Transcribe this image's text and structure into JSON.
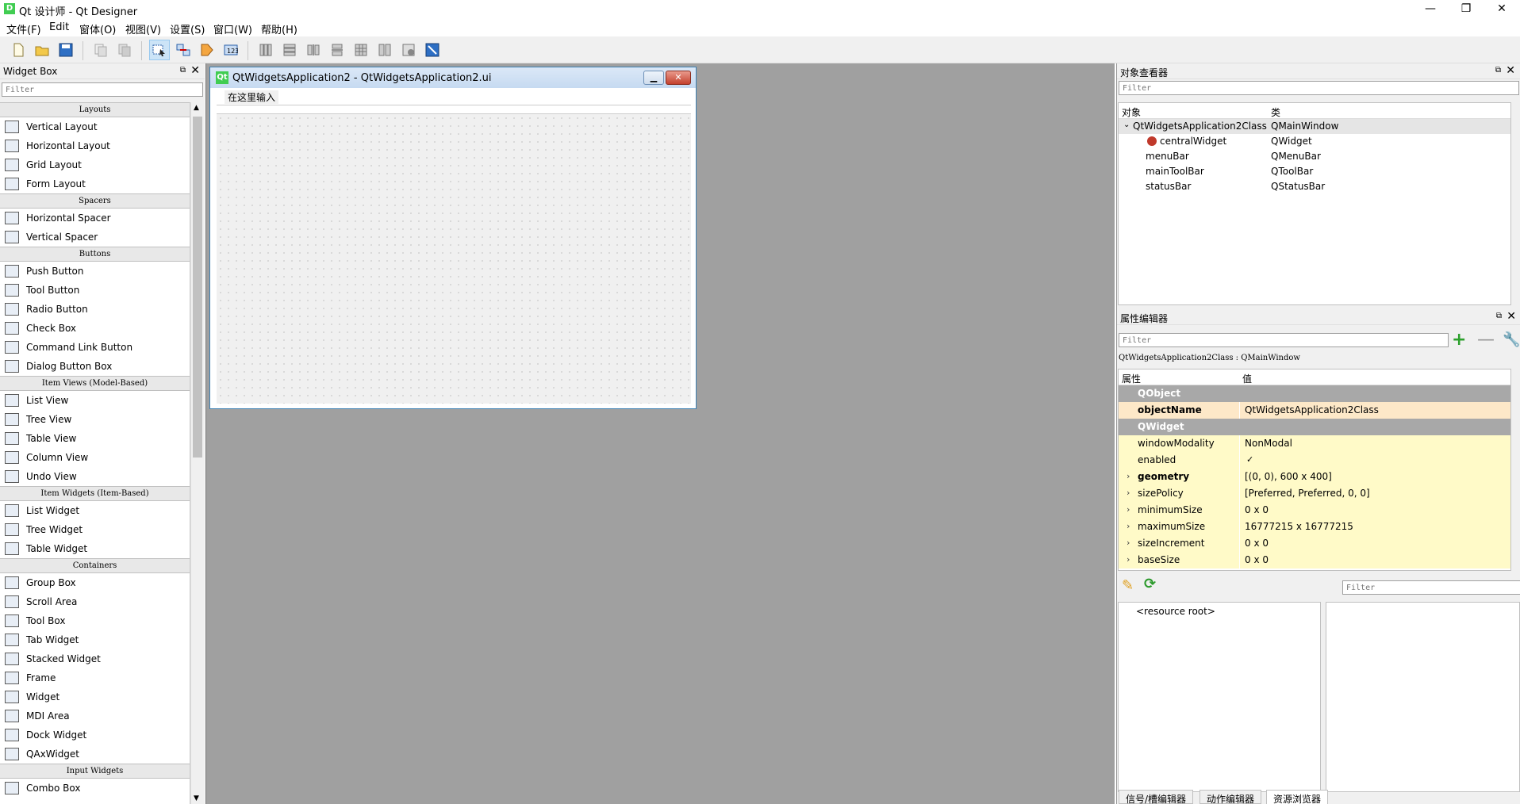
{
  "window": {
    "title": "Qt 设计师 - Qt Designer",
    "app_icon": "D",
    "min": "—",
    "max": "❐",
    "close": "✕"
  },
  "menu": [
    "文件(F)",
    "Edit",
    "窗体(O)",
    "视图(V)",
    "设置(S)",
    "窗口(W)",
    "帮助(H)"
  ],
  "widget_box": {
    "title": "Widget Box",
    "filter_placeholder": "Filter",
    "categories": [
      {
        "name": "Layouts",
        "items": [
          "Vertical Layout",
          "Horizontal Layout",
          "Grid Layout",
          "Form Layout"
        ]
      },
      {
        "name": "Spacers",
        "items": [
          "Horizontal Spacer",
          "Vertical Spacer"
        ]
      },
      {
        "name": "Buttons",
        "items": [
          "Push Button",
          "Tool Button",
          "Radio Button",
          "Check Box",
          "Command Link Button",
          "Dialog Button Box"
        ]
      },
      {
        "name": "Item Views (Model-Based)",
        "items": [
          "List View",
          "Tree View",
          "Table View",
          "Column View",
          "Undo View"
        ]
      },
      {
        "name": "Item Widgets (Item-Based)",
        "items": [
          "List Widget",
          "Tree Widget",
          "Table Widget"
        ]
      },
      {
        "name": "Containers",
        "items": [
          "Group Box",
          "Scroll Area",
          "Tool Box",
          "Tab Widget",
          "Stacked Widget",
          "Frame",
          "Widget",
          "MDI Area",
          "Dock Widget",
          "QAxWidget"
        ]
      },
      {
        "name": "Input Widgets",
        "items": [
          "Combo Box"
        ]
      }
    ]
  },
  "form": {
    "title": "QtWidgetsApplication2 - QtWidgetsApplication2.ui",
    "icon": "Qt",
    "menu_placeholder": "在这里输入"
  },
  "object_inspector": {
    "title": "对象查看器",
    "filter_placeholder": "Filter",
    "col_object": "对象",
    "col_class": "类",
    "rows": [
      {
        "object": "QtWidgetsApplication2Class",
        "class": "QMainWindow"
      },
      {
        "object": "centralWidget",
        "class": "QWidget"
      },
      {
        "object": "menuBar",
        "class": "QMenuBar"
      },
      {
        "object": "mainToolBar",
        "class": "QToolBar"
      },
      {
        "object": "statusBar",
        "class": "QStatusBar"
      }
    ]
  },
  "property_editor": {
    "title": "属性编辑器",
    "filter_placeholder": "Filter",
    "context": "QtWidgetsApplication2Class : QMainWindow",
    "col_property": "属性",
    "col_value": "值",
    "group_qobject": "QObject",
    "group_qwidget": "QWidget",
    "props": [
      {
        "name": "objectName",
        "value": "QtWidgetsApplication2Class",
        "bold": true,
        "group": "QObject"
      },
      {
        "name": "windowModality",
        "value": "NonModal",
        "bold": false
      },
      {
        "name": "enabled",
        "value": "✓",
        "bold": false
      },
      {
        "name": "geometry",
        "value": "[(0, 0), 600 x 400]",
        "bold": true,
        "expand": true
      },
      {
        "name": "sizePolicy",
        "value": "[Preferred, Preferred, 0, 0]",
        "bold": false,
        "expand": true
      },
      {
        "name": "minimumSize",
        "value": "0 x 0",
        "bold": false,
        "expand": true
      },
      {
        "name": "maximumSize",
        "value": "16777215 x 16777215",
        "bold": false,
        "expand": true
      },
      {
        "name": "sizeIncrement",
        "value": "0 x 0",
        "bold": false,
        "expand": true
      },
      {
        "name": "baseSize",
        "value": "0 x 0",
        "bold": false,
        "expand": true
      }
    ]
  },
  "resource_browser": {
    "filter_placeholder": "Filter",
    "root": "<resource root>"
  },
  "bottom_tabs": [
    "信号/槽编辑器",
    "动作编辑器",
    "资源浏览器"
  ],
  "colors": {
    "accent": "#41cd52",
    "selection": "#cce4f7",
    "prop_yellow": "#fffac8",
    "prop_orange": "#fde8c8"
  }
}
